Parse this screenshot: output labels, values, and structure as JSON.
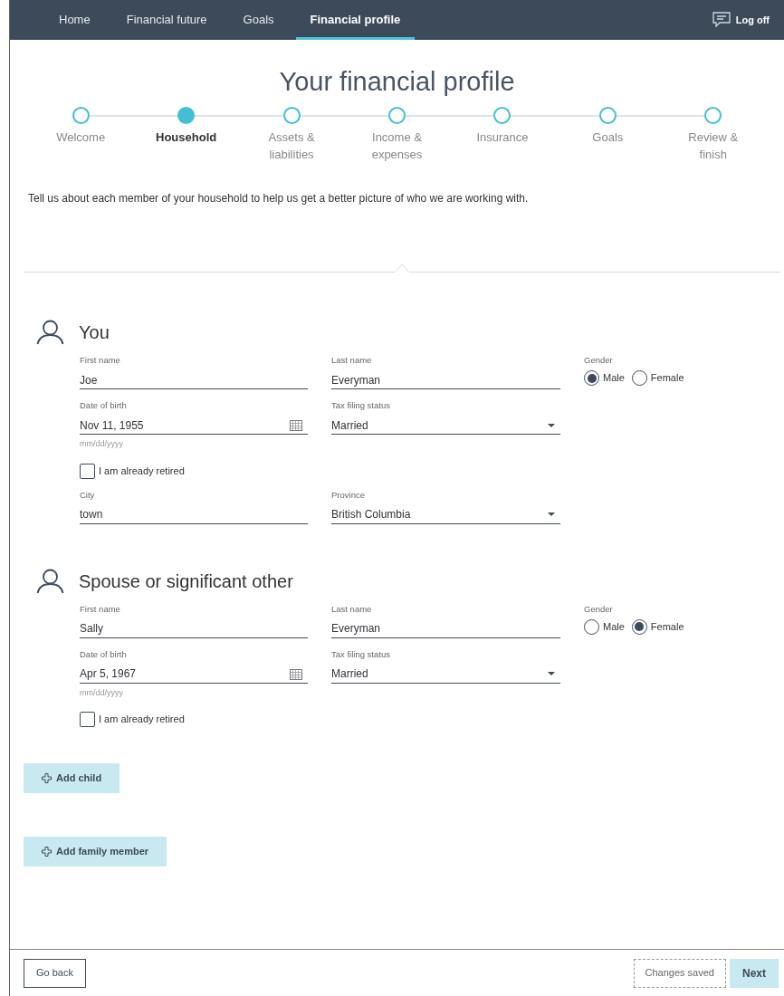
{
  "nav": {
    "tabs": [
      {
        "label": "Home",
        "selected": false
      },
      {
        "label": "Financial future",
        "selected": false
      },
      {
        "label": "Goals",
        "selected": false
      },
      {
        "label": "Financial profile",
        "selected": true
      }
    ],
    "logoff": "Log off"
  },
  "title": "Your financial profile",
  "steps": [
    {
      "label": "Welcome",
      "selected": false
    },
    {
      "label": "Household",
      "selected": true
    },
    {
      "label": "Assets & liabilities",
      "selected": false
    },
    {
      "label": "Income & expenses",
      "selected": false
    },
    {
      "label": "Insurance",
      "selected": false
    },
    {
      "label": "Goals",
      "selected": false
    },
    {
      "label": "Review & finish",
      "selected": false
    }
  ],
  "description": "Tell us about each member of your household to help us get a better picture of who we are working with.",
  "people": [
    {
      "heading": "You",
      "first_name": {
        "label": "First name",
        "value": "Joe"
      },
      "last_name": {
        "label": "Last name",
        "value": "Everyman"
      },
      "gender": {
        "label": "Gender",
        "options": [
          {
            "label": "Male",
            "selected": true
          },
          {
            "label": "Female",
            "selected": false
          }
        ]
      },
      "birth_date": {
        "label": "Date of birth",
        "value": "Nov 11, 1955",
        "hint": "mm/dd/yyyy"
      },
      "tax_status": {
        "label": "Tax filing status",
        "value": "Married"
      },
      "retired": {
        "label": "I am already retired",
        "checked": false
      },
      "city": {
        "label": "City",
        "value": "town"
      },
      "province": {
        "label": "Province",
        "value": "British Columbia"
      }
    },
    {
      "heading": "Spouse or significant other",
      "first_name": {
        "label": "First name",
        "value": "Sally"
      },
      "last_name": {
        "label": "Last name",
        "value": "Everyman"
      },
      "gender": {
        "label": "Gender",
        "options": [
          {
            "label": "Male",
            "selected": false
          },
          {
            "label": "Female",
            "selected": true
          }
        ]
      },
      "birth_date": {
        "label": "Date of birth",
        "value": "Apr 5, 1967",
        "hint": "mm/dd/yyyy"
      },
      "tax_status": {
        "label": "Tax filing status",
        "value": "Married"
      },
      "retired": {
        "label": "I am already retired",
        "checked": false
      }
    }
  ],
  "add_buttons": [
    "Add child",
    "Add family member"
  ],
  "footer": {
    "back": "Go back",
    "status": "Changes saved",
    "next": "Next"
  }
}
